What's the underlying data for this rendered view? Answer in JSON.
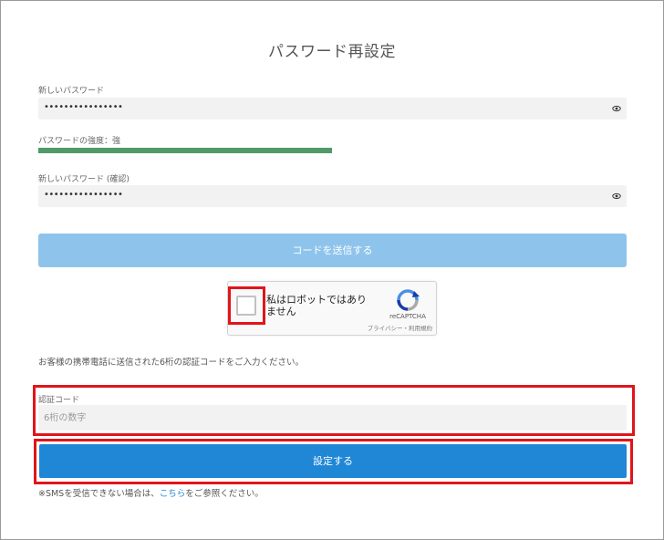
{
  "page": {
    "title": "パスワード再設定"
  },
  "new_password": {
    "label": "新しいパスワード",
    "value": "••••••••••••••••"
  },
  "strength": {
    "label": "パスワードの強度：強",
    "level": 0.5,
    "color": "#4f9a68"
  },
  "confirm_password": {
    "label": "新しいパスワード (確認)",
    "value": "••••••••••••••••"
  },
  "send_code_button": {
    "label": "コードを送信する",
    "color": "#8ec4ec"
  },
  "recaptcha": {
    "checkbox_label_line1": "私はロボットではあり",
    "checkbox_label_line2": "ません",
    "brand": "reCAPTCHA",
    "links": "プライバシー・利用規約"
  },
  "info_text": "お客様の携帯電話に送信された6桁の認証コードをご入力ください。",
  "verification_code": {
    "label": "認証コード",
    "placeholder": "6桁の数字"
  },
  "submit_button": {
    "label": "設定する",
    "color": "#1f87d6"
  },
  "sms_note": {
    "prefix": "※SMSを受信できない場合は、",
    "link": "こちら",
    "suffix": "をご参照ください。"
  },
  "highlight_color": "#e0151b"
}
